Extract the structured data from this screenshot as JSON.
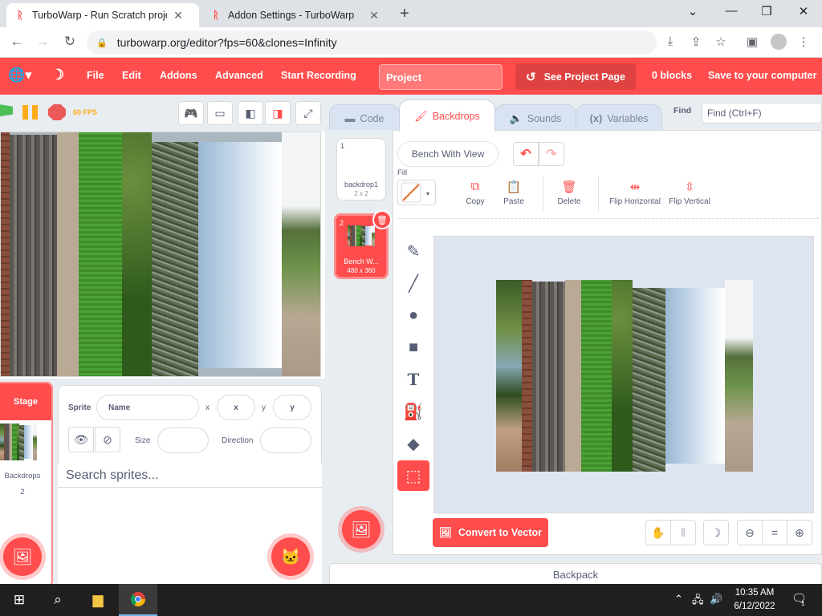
{
  "browser": {
    "tabs": [
      {
        "title": "TurboWarp - Run Scratch projects",
        "active": true
      },
      {
        "title": "Addon Settings - TurboWarp",
        "active": false
      }
    ],
    "url": "turbowarp.org/editor?fps=60&clones=Infinity"
  },
  "menubar": {
    "file": "File",
    "edit": "Edit",
    "addons": "Addons",
    "advanced": "Advanced",
    "start_recording": "Start Recording",
    "project_title": "Project",
    "see_project_page": "See Project Page",
    "blocks_count": "0 blocks",
    "save": "Save to your computer",
    "accent": "#ff4c4c"
  },
  "stage_controls": {
    "fps": "60 FPS"
  },
  "editor_tabs": {
    "code": "Code",
    "backdrops": "Backdrops",
    "sounds": "Sounds",
    "variables": "Variables",
    "find_label": "Find",
    "find_placeholder": "Find (Ctrl+F)"
  },
  "costumes": [
    {
      "number": "1",
      "name": "backdrop1",
      "size": "2 x 2"
    },
    {
      "number": "2",
      "name": "Bench W...",
      "size": "480 x 360",
      "selected": true
    }
  ],
  "paint_editor": {
    "costume_name": "Bench With View",
    "fill_label": "Fill",
    "copy": "Copy",
    "paste": "Paste",
    "delete": "Delete",
    "flip_horizontal": "Flip Horizontal",
    "flip_vertical": "Flip Vertical",
    "convert": "Convert to Vector"
  },
  "sprite_pane": {
    "stage_label": "Stage",
    "backdrops_label": "Backdrops",
    "backdrops_count": "2",
    "sprite_label": "Sprite",
    "name_placeholder": "Name",
    "x_label": "x",
    "x_placeholder": "x",
    "y_label": "y",
    "y_placeholder": "y",
    "size_label": "Size",
    "direction_label": "Direction",
    "search_placeholder": "Search sprites..."
  },
  "backpack": "Backpack",
  "taskbar": {
    "time": "10:35 AM",
    "date": "6/12/2022",
    "notifications": "1"
  }
}
